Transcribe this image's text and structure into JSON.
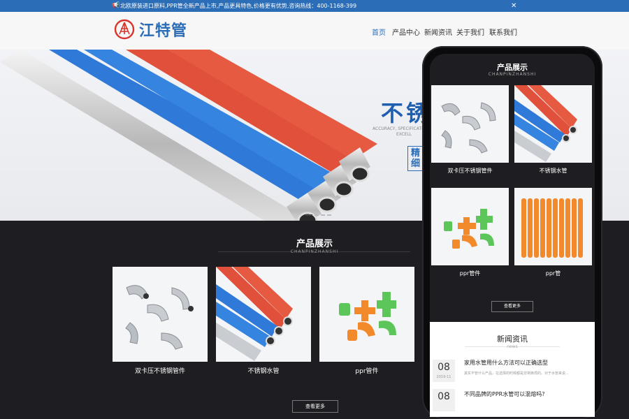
{
  "topbar": {
    "notice": "北欧原装进口原料,PPR管全新产品上市,产品更具特色,价格更有优势,咨询热线：400-1168-399",
    "icon": "megaphone-icon",
    "close_icon": "close-icon"
  },
  "header": {
    "brand": "江特管",
    "nav": [
      "首页",
      "产品中心",
      "新闻资讯",
      "关于我们",
      "联系我们"
    ]
  },
  "banner": {
    "headline": "不锈",
    "sub1": "ACCURACY, SPECIFICATI",
    "sub2": "EXCELL",
    "tag": "精 细",
    "slides": 4,
    "active_slide": 1
  },
  "products": {
    "title": "产品展示",
    "subtitle": "CHANPINZHANSHI",
    "items": [
      "双卡压不锈钢管件",
      "不锈钢水管",
      "ppr管件"
    ],
    "more": "查看更多"
  },
  "mobile": {
    "products": {
      "title": "产品展示",
      "subtitle": "CHANPINZHANSHI",
      "items": [
        "双卡压不锈钢管件",
        "不锈钢水管",
        "ppr管件",
        "ppr管"
      ],
      "more": "查看更多"
    },
    "news": {
      "title": "新闻资讯",
      "subtitle": "news",
      "items": [
        {
          "day": "08",
          "ym": "2019-11",
          "headline": "家用水管用什么方法可以正确选型",
          "excerpt": "其实不管什么产品，在选择的时候都是非常麻烦的。对于水管来说..."
        },
        {
          "day": "08",
          "ym": "",
          "headline": "不同品牌的PPR水管可以混熔吗?",
          "excerpt": ""
        }
      ]
    }
  },
  "colors": {
    "brand_blue": "#2b6db7",
    "dark_bg": "#1e1e22",
    "pipe_red": "#e0503a",
    "pipe_blue": "#2f7ad8",
    "ppr_green": "#5cc65a",
    "ppr_orange": "#f28a2c"
  }
}
